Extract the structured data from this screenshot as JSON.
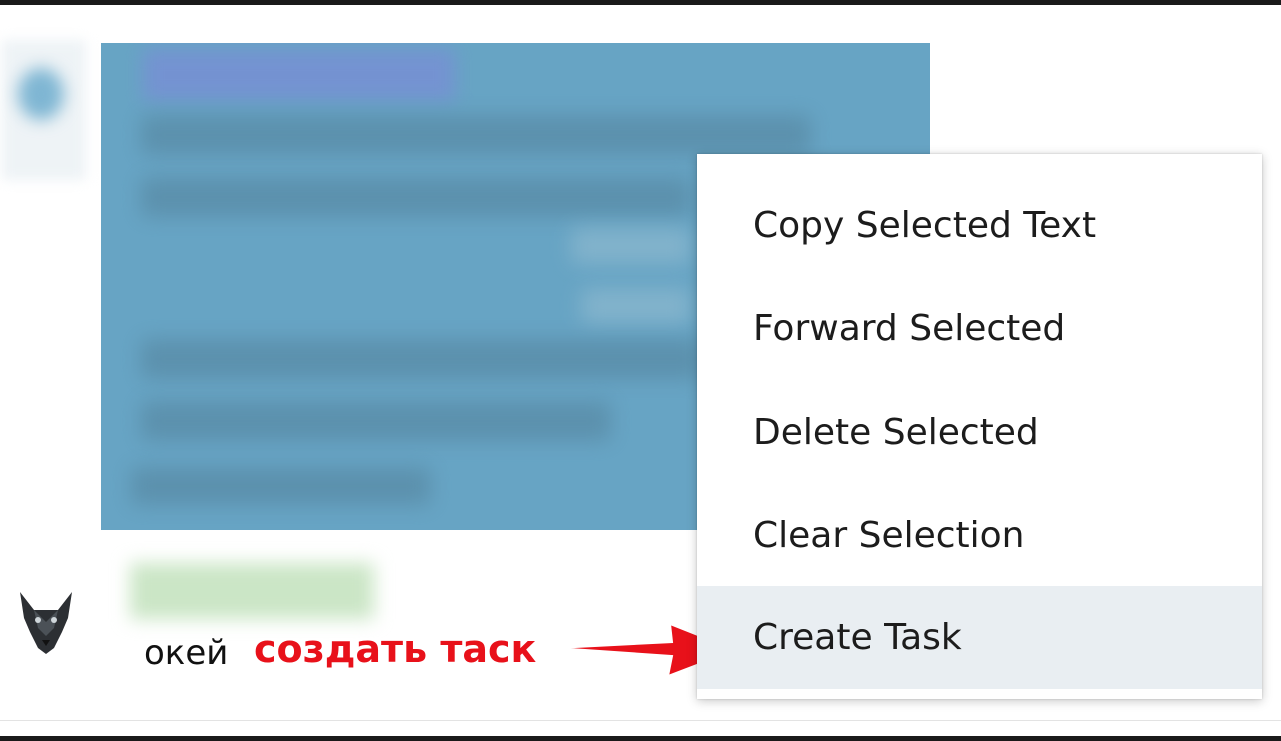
{
  "context_menu": {
    "items": [
      {
        "label": "Copy Selected Text"
      },
      {
        "label": "Forward Selected"
      },
      {
        "label": "Delete Selected"
      },
      {
        "label": "Clear Selection"
      },
      {
        "label": "Create Task",
        "highlighted": true
      }
    ]
  },
  "second_message": {
    "text": "окей"
  },
  "annotation": {
    "text": "создать таск",
    "color": "#e8111a"
  },
  "colors": {
    "selection_bg": "#67a4c4",
    "menu_hover_bg": "#e9eef2"
  },
  "icons": {
    "sender_avatar": "wolf-avatar-icon",
    "annotation_arrow": "red-arrow-icon"
  }
}
